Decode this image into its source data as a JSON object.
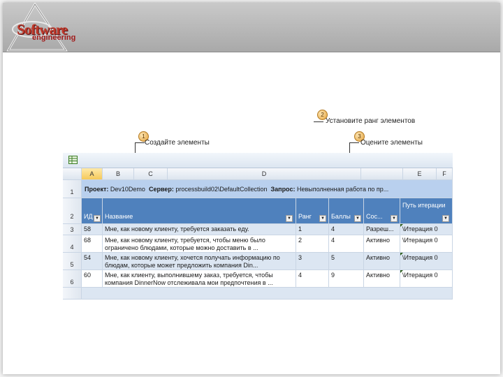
{
  "logo": {
    "word1": "Software",
    "word2": "engineering"
  },
  "callouts": [
    {
      "number": "1",
      "label": "Создайте элементы"
    },
    {
      "number": "2",
      "label": "Установите ранг элементов"
    },
    {
      "number": "3",
      "label": "Оцените элементы"
    }
  ],
  "sheet": {
    "icon": "excel-sheet-icon",
    "columns": [
      "A",
      "B",
      "C",
      "D",
      "E",
      "F"
    ],
    "row_numbers": [
      "1",
      "2",
      "3",
      "4",
      "5",
      "6"
    ],
    "info": {
      "project_label": "Проект:",
      "project_value": "Dev10Demo",
      "server_label": "Сервер:",
      "server_value": "processbuild02\\DefaultCollection",
      "query_label": "Запрос:",
      "query_value": "Невыполненная работа по пр..."
    },
    "headers": {
      "id": "ИД",
      "title": "Название",
      "rank": "Ранг",
      "points": "Баллы",
      "state": "Сос...",
      "iteration": "Путь итерации"
    },
    "rows": [
      {
        "id": "58",
        "title": "Мне, как новому клиенту, требуется заказать еду.",
        "rank": "1",
        "points": "4",
        "state": "Разреш...",
        "iteration": "\\Итерация 0"
      },
      {
        "id": "68",
        "title": "Мне, как новому клиенту, требуется, чтобы меню было ограничено блюдами, которые можно доставить в ...",
        "rank": "2",
        "points": "4",
        "state": "Активно",
        "iteration": "\\Итерация 0"
      },
      {
        "id": "54",
        "title": "Мне, как новому клиенту, хочется получать информацию по блюдам, которые может предложить компания Din...",
        "rank": "3",
        "points": "5",
        "state": "Активно",
        "iteration": "\\Итерация 0"
      },
      {
        "id": "60",
        "title": "Мне, как клиенту, выполнившему заказ, требуется, чтобы компания DinnerNow отслеживала мои предпочтения в ...",
        "rank": "4",
        "points": "9",
        "state": "Активно",
        "iteration": "\\Итерация 0"
      }
    ]
  }
}
